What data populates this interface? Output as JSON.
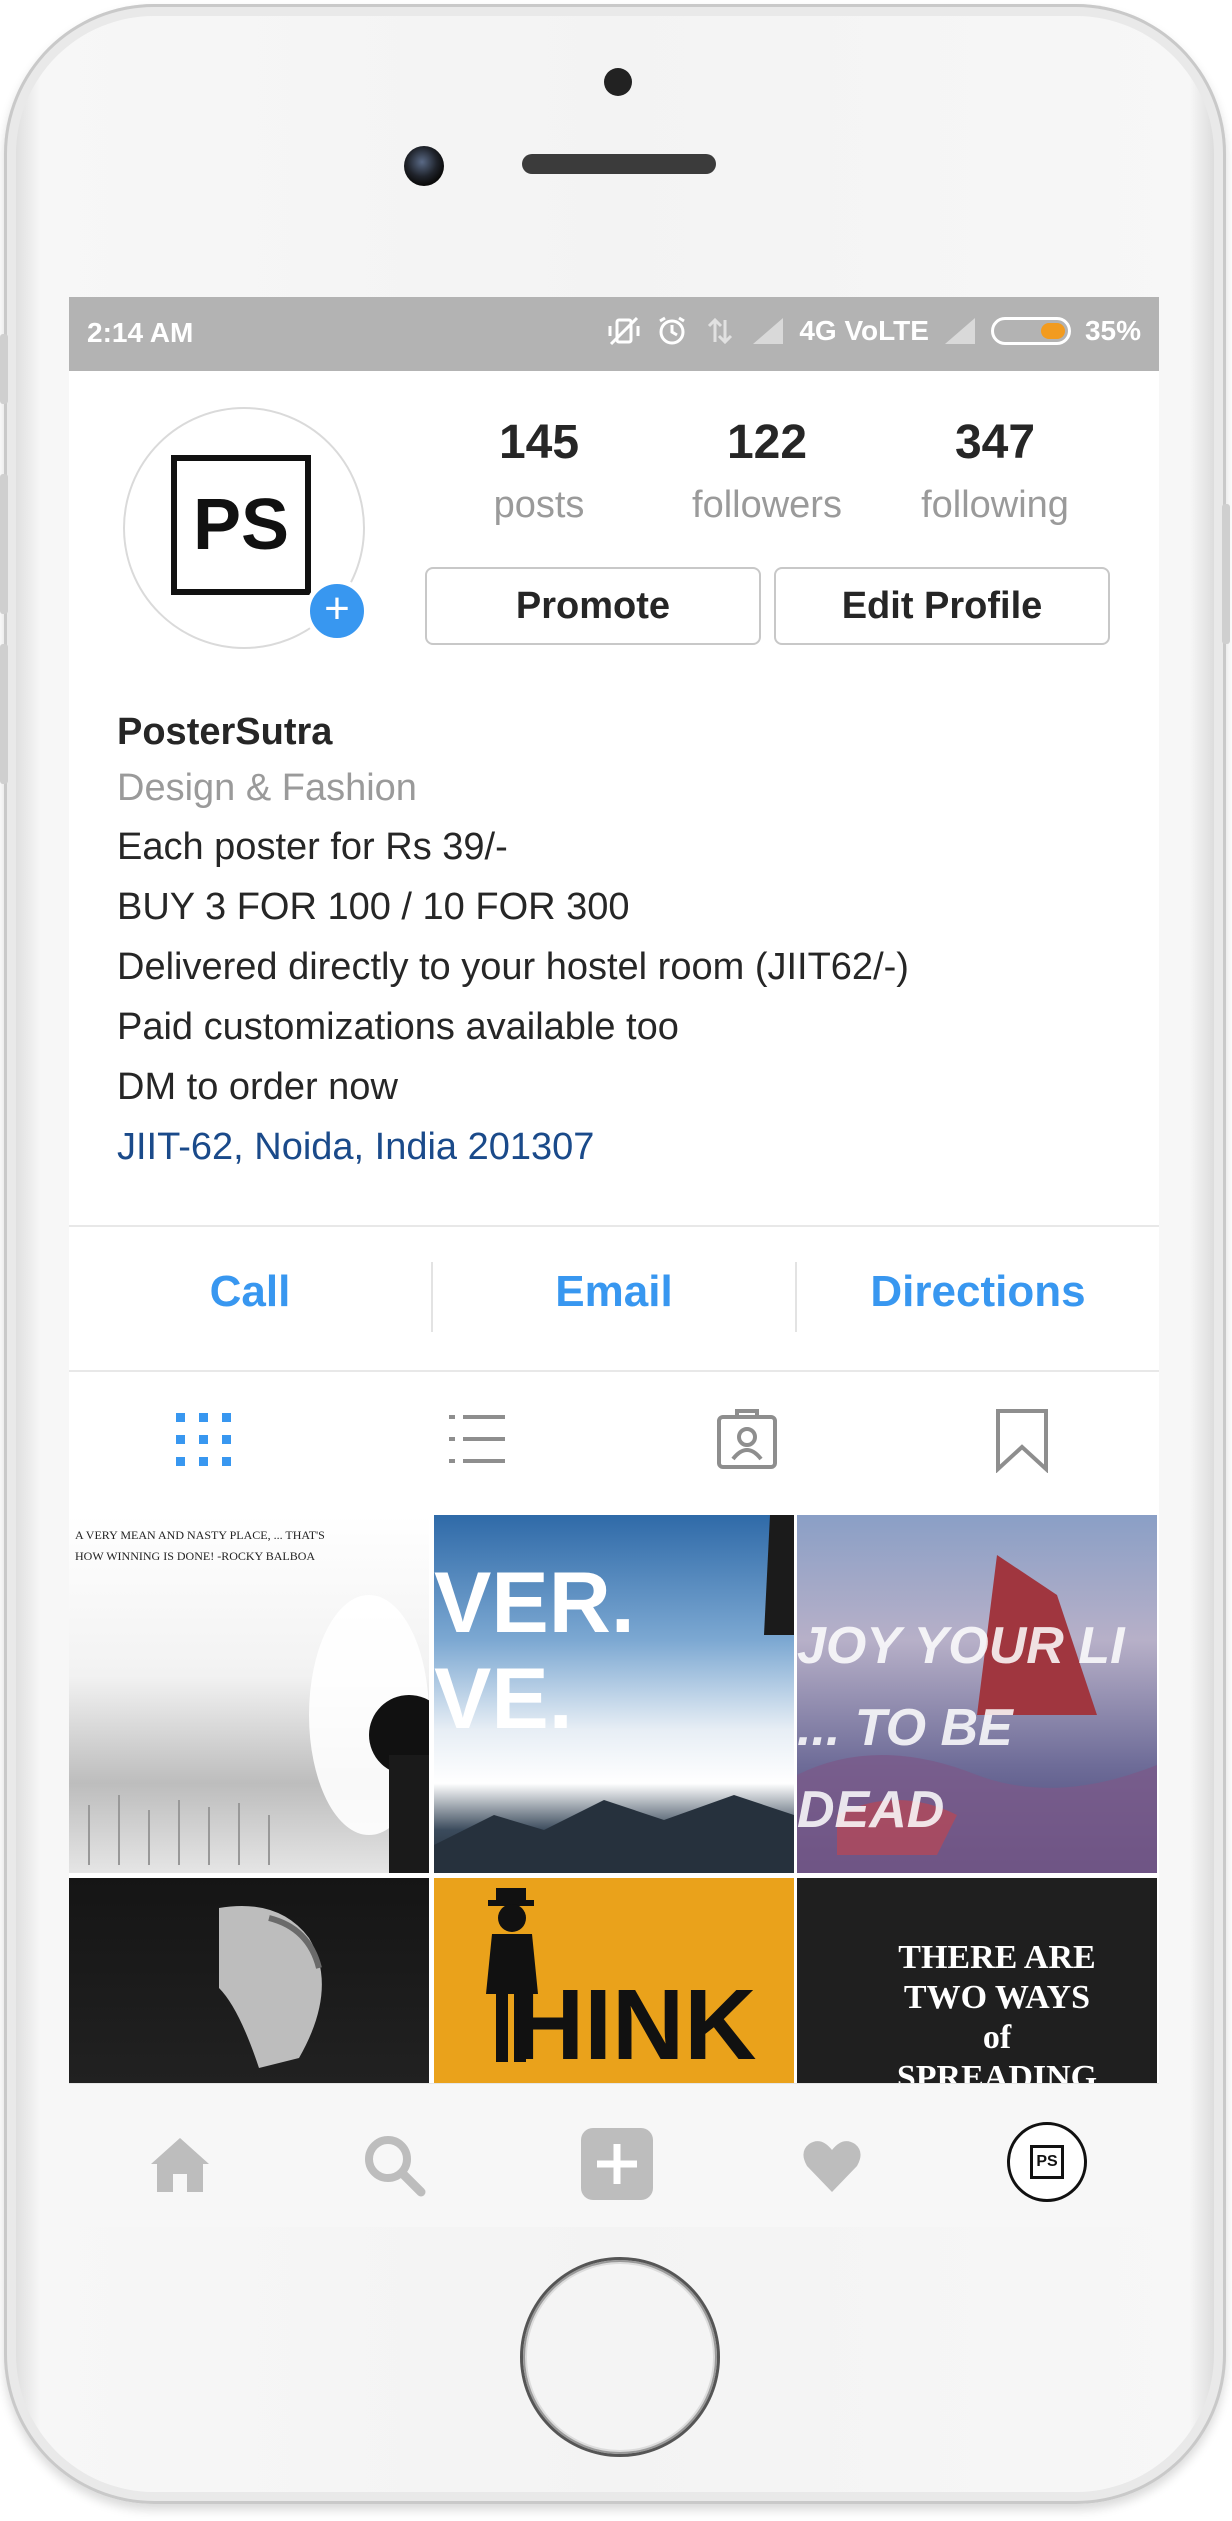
{
  "status_bar": {
    "time": "2:14 AM",
    "network": "4G VoLTE",
    "battery": "35%",
    "battery_level": 0.35
  },
  "profile": {
    "avatar_text": "PS",
    "stats": [
      {
        "value": "145",
        "label": "posts"
      },
      {
        "value": "122",
        "label": "followers"
      },
      {
        "value": "347",
        "label": "following"
      }
    ],
    "promote_label": "Promote",
    "edit_label": "Edit Profile",
    "name": "PosterSutra",
    "category": "Design & Fashion",
    "bio_lines": [
      "Each poster for Rs 39/-",
      "BUY 3 FOR 100 / 10 FOR 300",
      "Delivered directly to your hostel room (JIIT62/-)",
      "Paid customizations available too",
      "DM to order now"
    ],
    "location": "JIIT-62, Noida, India 201307"
  },
  "contact": {
    "call": "Call",
    "email": "Email",
    "directions": "Directions"
  },
  "tabs": [
    "grid-icon",
    "list-icon",
    "tagged-icon",
    "saved-icon"
  ],
  "posts": [
    {
      "text": "A VERY MEAN AND NASTY PLACE, ... THAT'S HOW WINNING IS DONE! -ROCKY BALBOA"
    },
    {
      "text": "VER. VE."
    },
    {
      "text": "JOY YOUR LI ... TO BE DEAD"
    },
    {
      "text": ""
    },
    {
      "text": "HINK"
    },
    {
      "text": "THERE ARE TWO WAYS of SPREADING LIGHT Candle"
    }
  ],
  "bottom_nav": [
    "home-icon",
    "search-icon",
    "add-post-icon",
    "activity-icon",
    "profile-icon"
  ],
  "colors": {
    "accent": "#3897f0",
    "location_link": "#1a4a8a",
    "status_bar": "#b3b3b3",
    "battery_fill": "#f29b1f"
  }
}
